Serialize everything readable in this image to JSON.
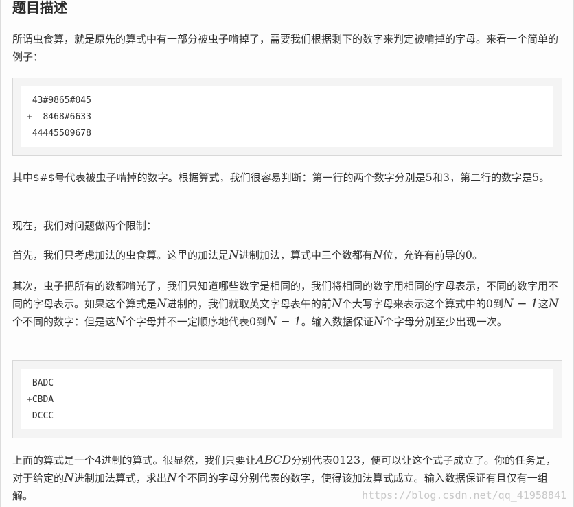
{
  "heading": "题目描述",
  "para1": "所谓虫食算，就是原先的算式中有一部分被虫子啃掉了，需要我们根据剩下的数字来判定被啃掉的字母。来看一个简单的例子：",
  "code1": [
    " 43#9865#045",
    "+  8468#6633",
    " 44445509678"
  ],
  "para2": {
    "a": "其中$#$号代表被虫子啃掉的数字。根据算式，我们很容易判断：第一行的两个数字分别是",
    "n1": "5",
    "b": "和",
    "n2": "3",
    "c": "，第二行的数字是",
    "n3": "5",
    "d": "。"
  },
  "para3": "现在，我们对问题做两个限制：",
  "para4": {
    "a": "首先，我们只考虑加法的虫食算。这里的加法是",
    "m1": "N",
    "b": "进制加法，算式中三个数都有",
    "m2": "N",
    "c": "位，允许有前导的",
    "n1": "0",
    "d": "。"
  },
  "para5": {
    "a": "其次，虫子把所有的数都啃光了，我们只知道哪些数字是相同的，我们将相同的数字用相同的字母表示，不同的数字用不同的字母表示。如果这个算式是",
    "m1": "N",
    "b": "进制的，我们就取英文字母表午的前",
    "m2": "N",
    "c": "个大写字母来表示这个算式中的",
    "n1": "0",
    "d": "到",
    "m3": "N − 1",
    "e": "这",
    "m4": "N",
    "f": "个不同的数字：但是这",
    "m5": "N",
    "g": "个字母并不一定顺序地代表",
    "n2": "0",
    "h": "到",
    "m6": "N − 1",
    "i": "。输入数据保证",
    "m7": "N",
    "j": "个字母分别至少出现一次。"
  },
  "code2": [
    " BADC",
    "+CBDA",
    " DCCC"
  ],
  "para6": {
    "a": "上面的算式是一个4进制的算式。很显然，我们只要让",
    "m1": "ABCD",
    "b": "分别代表",
    "n1": "0123",
    "c": "，便可以让这个式子成立了。你的任务是，对于给定的",
    "m2": "N",
    "d": "进制加法算式，求出",
    "m3": "N",
    "e": "个不同的字母分别代表的数字，使得该加法算式成立。输入数据保证有且仅有一组解。"
  },
  "watermark": "https://blog.csdn.net/qq_41958841"
}
